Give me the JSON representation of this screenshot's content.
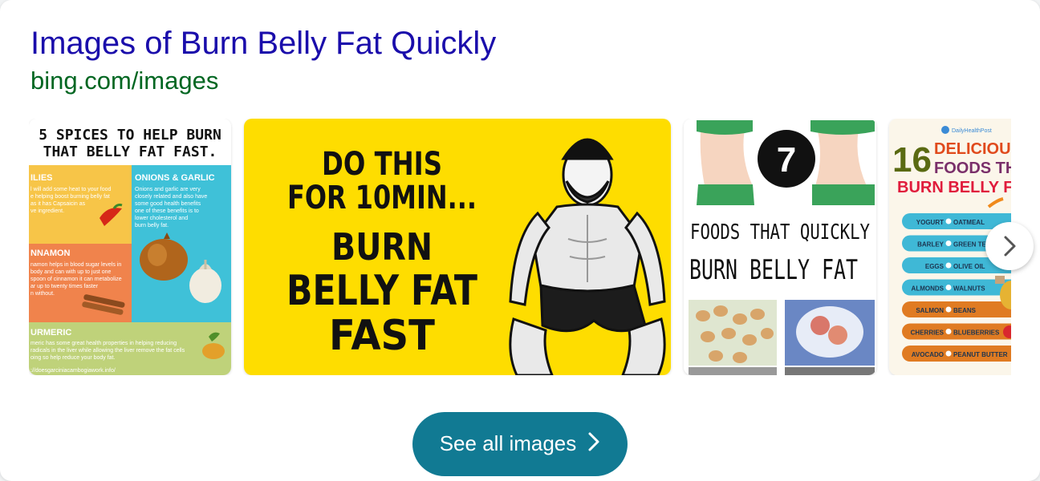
{
  "header": {
    "title": "Images of Burn Belly Fat Quickly",
    "source": "bing.com/images"
  },
  "images": [
    {
      "headline_line1": "5 SPICES TO HELP BURN",
      "headline_line2": "THAT BELLY FAT FAST.",
      "sections": [
        {
          "name": "ILIES",
          "text": [
            "l will add some heat to your food",
            "e helping boost burning belly fat",
            " as it has Capsaicin as",
            "ve ingredient."
          ]
        },
        {
          "name": "ONIONS & GARLIC",
          "text": [
            "Onions and garlic are very",
            "closely related and also have",
            "some good health benefits",
            "one of these benefits is to",
            "lower cholesterol and",
            "burn belly fat."
          ]
        },
        {
          "name": "NNAMON",
          "text": [
            "namon helps in blood sugar levels in",
            " body and can with up to just one",
            "spoon of cinnamon it can metabolize",
            "ar up to twenty times faster",
            "n without."
          ]
        },
        {
          "name": "URMERIC",
          "text": [
            "meric has some great health properties in helping reducing",
            " radicals in the liver while allowing the liver remove the fat cells",
            "oing so help reduce your body fat."
          ]
        }
      ],
      "footer": "://doesgarciniacambogiawork.info/"
    },
    {
      "lines": [
        "DO THIS",
        "FOR 10MIN...",
        "BURN",
        "BELLY FAT",
        "FAST"
      ]
    },
    {
      "number": "7",
      "line1": "FOODS THAT QUICKLY",
      "line2": "BURN BELLY FAT"
    },
    {
      "brand": "DailyHealthPost",
      "number": "16",
      "line1": "DELICIOUS",
      "line2": "FOODS THAT",
      "line3": "BURN BELLY FAT",
      "pills": [
        {
          "left": "YOGURT",
          "right": "OATMEAL"
        },
        {
          "left": "BARLEY",
          "right": "GREEN TE"
        },
        {
          "left": "EGGS",
          "right": "OLIVE OIL"
        },
        {
          "left": "ALMONDS",
          "right": "WALNUTS"
        },
        {
          "left": "SALMON",
          "right": "BEANS"
        },
        {
          "left": "CHERRIES",
          "right": "BLUEBERRIES"
        },
        {
          "left": "AVOCADO",
          "right": "PEANUT BUTTER"
        }
      ]
    }
  ],
  "see_all": {
    "label": "See all images"
  },
  "colors": {
    "title": "#1a0dab",
    "url": "#006621",
    "see_all_bg": "#117a93",
    "yellow": "#fedd00"
  },
  "icons": {
    "next": "chevron-right-icon",
    "see_all_chevron": "chevron-right-icon"
  }
}
